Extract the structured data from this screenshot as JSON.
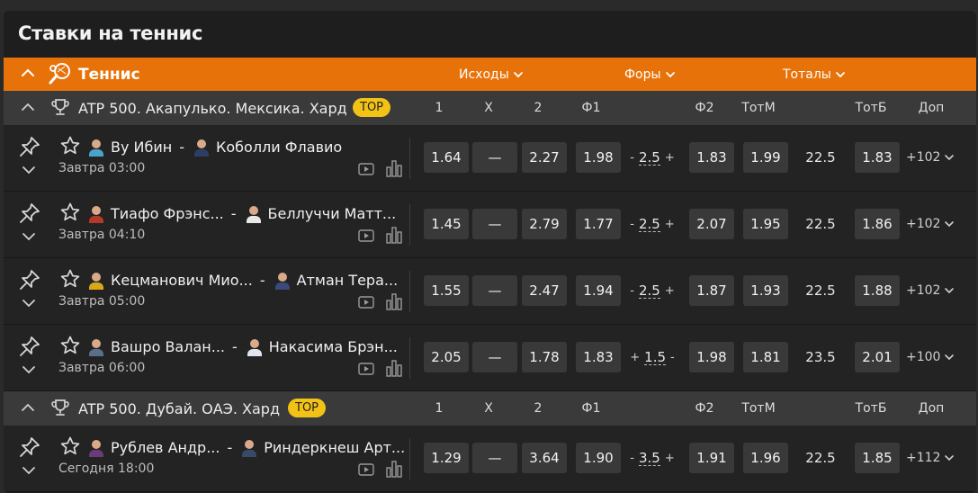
{
  "page_title": "Ставки на теннис",
  "sport_bar": {
    "sport": "Теннис",
    "dropdowns": [
      {
        "label": "Исходы"
      },
      {
        "label": "Форы"
      },
      {
        "label": "Тоталы"
      }
    ]
  },
  "columns": {
    "c1": "1",
    "cx": "X",
    "c2": "2",
    "f1": "Ф1",
    "f2": "Ф2",
    "totm": "ТотМ",
    "totb": "ТотБ",
    "dop": "Доп"
  },
  "leagues": [
    {
      "name": "ATP 500. Акапулько. Мексика. Хард",
      "badge": "TOP",
      "matches": [
        {
          "p1": "Ву Ибин",
          "p2": "Коболли Флавио",
          "time": "Завтра 03:00",
          "o1": "1.64",
          "ox": "—",
          "o2": "2.27",
          "f1": "1.98",
          "hsign_l": "-",
          "hval": "2.5",
          "hsign_r": "+",
          "f2": "1.83",
          "tm": "1.99",
          "tval": "22.5",
          "tb": "1.83",
          "more": "+102"
        },
        {
          "p1": "Тиафо Фрэнс...",
          "p2": "Беллуччи Матт...",
          "time": "Завтра 04:10",
          "o1": "1.45",
          "ox": "—",
          "o2": "2.79",
          "f1": "1.77",
          "hsign_l": "-",
          "hval": "2.5",
          "hsign_r": "+",
          "f2": "2.07",
          "tm": "1.95",
          "tval": "22.5",
          "tb": "1.86",
          "more": "+102"
        },
        {
          "p1": "Кецманович Мио...",
          "p2": "Атман Тера...",
          "time": "Завтра 05:00",
          "o1": "1.55",
          "ox": "—",
          "o2": "2.47",
          "f1": "1.94",
          "hsign_l": "-",
          "hval": "2.5",
          "hsign_r": "+",
          "f2": "1.87",
          "tm": "1.93",
          "tval": "22.5",
          "tb": "1.88",
          "more": "+102"
        },
        {
          "p1": "Вашро Валан...",
          "p2": "Накасима Брэн...",
          "time": "Завтра 06:00",
          "o1": "2.05",
          "ox": "—",
          "o2": "1.78",
          "f1": "1.83",
          "hsign_l": "+",
          "hval": "1.5",
          "hsign_r": "-",
          "f2": "1.98",
          "tm": "1.81",
          "tval": "23.5",
          "tb": "2.01",
          "more": "+100"
        }
      ]
    },
    {
      "name": "ATP 500. Дубай. ОАЭ. Хард",
      "badge": "TOP",
      "matches": [
        {
          "p1": "Рублев Андр...",
          "p2": "Риндеркнеш Арт...",
          "time": "Сегодня 18:00",
          "o1": "1.29",
          "ox": "—",
          "o2": "3.64",
          "f1": "1.90",
          "hsign_l": "-",
          "hval": "3.5",
          "hsign_r": "+",
          "f2": "1.91",
          "tm": "1.96",
          "tval": "22.5",
          "tb": "1.85",
          "more": "+112"
        }
      ]
    }
  ],
  "colors": {
    "accent": "#e8720a",
    "badge": "#f2c316"
  }
}
